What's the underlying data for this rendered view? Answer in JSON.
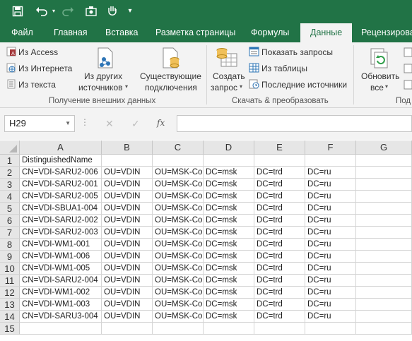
{
  "quick_access": {
    "customize": "▾"
  },
  "tabs": [
    "Файл",
    "Главная",
    "Вставка",
    "Разметка страницы",
    "Формулы",
    "Данные",
    "Рецензирова"
  ],
  "active_tab": "Данные",
  "ribbon": {
    "get_external": {
      "from_access": "Из Access",
      "from_web": "Из Интернета",
      "from_text": "Из текста",
      "other_sources_1": "Из других",
      "other_sources_2": "источников",
      "existing_1": "Существующие",
      "existing_2": "подключения",
      "group_label": "Получение внешних данных"
    },
    "transform": {
      "new_query_1": "Создать",
      "new_query_2": "запрос",
      "show_queries": "Показать запросы",
      "from_table": "Из таблицы",
      "recent_sources": "Последние источники",
      "group_label": "Скачать & преобразовать"
    },
    "connections": {
      "refresh_1": "Обновить",
      "refresh_2": "все",
      "group_label": "Под"
    }
  },
  "formula_bar": {
    "name_box": "H29",
    "fx_label": "fx",
    "value": ""
  },
  "sheet": {
    "columns": [
      "A",
      "B",
      "C",
      "D",
      "E",
      "F",
      "G"
    ],
    "rows": [
      [
        "DistinguishedName",
        "",
        "",
        "",
        "",
        "",
        ""
      ],
      [
        "CN=VDI-SARU2-006",
        "OU=VDIN",
        "OU=MSK-Cor",
        "DC=msk",
        "DC=trd",
        "DC=ru",
        ""
      ],
      [
        "CN=VDI-SARU2-001",
        "OU=VDIN",
        "OU=MSK-Cor",
        "DC=msk",
        "DC=trd",
        "DC=ru",
        ""
      ],
      [
        "CN=VDI-SARU2-005",
        "OU=VDIN",
        "OU=MSK-Cor",
        "DC=msk",
        "DC=trd",
        "DC=ru",
        ""
      ],
      [
        "CN=VDI-SBUA1-004",
        "OU=VDIN",
        "OU=MSK-Cor",
        "DC=msk",
        "DC=trd",
        "DC=ru",
        ""
      ],
      [
        "CN=VDI-SARU2-002",
        "OU=VDIN",
        "OU=MSK-Cor",
        "DC=msk",
        "DC=trd",
        "DC=ru",
        ""
      ],
      [
        "CN=VDI-SARU2-003",
        "OU=VDIN",
        "OU=MSK-Cor",
        "DC=msk",
        "DC=trd",
        "DC=ru",
        ""
      ],
      [
        "CN=VDI-WM1-001",
        "OU=VDIN",
        "OU=MSK-Cor",
        "DC=msk",
        "DC=trd",
        "DC=ru",
        ""
      ],
      [
        "CN=VDI-WM1-006",
        "OU=VDIN",
        "OU=MSK-Cor",
        "DC=msk",
        "DC=trd",
        "DC=ru",
        ""
      ],
      [
        "CN=VDI-WM1-005",
        "OU=VDIN",
        "OU=MSK-Cor",
        "DC=msk",
        "DC=trd",
        "DC=ru",
        ""
      ],
      [
        "CN=VDI-SARU2-004",
        "OU=VDIN",
        "OU=MSK-Cor",
        "DC=msk",
        "DC=trd",
        "DC=ru",
        ""
      ],
      [
        "CN=VDI-WM1-002",
        "OU=VDIN",
        "OU=MSK-Cor",
        "DC=msk",
        "DC=trd",
        "DC=ru",
        ""
      ],
      [
        "CN=VDI-WM1-003",
        "OU=VDIN",
        "OU=MSK-Cor",
        "DC=msk",
        "DC=trd",
        "DC=ru",
        ""
      ],
      [
        "CN=VDI-SARU3-004",
        "OU=VDIN",
        "OU=MSK-Cor",
        "DC=msk",
        "DC=trd",
        "DC=ru",
        ""
      ],
      [
        "",
        "",
        "",
        "",
        "",
        "",
        ""
      ]
    ]
  },
  "colors": {
    "accent": "#217346",
    "ribbon_bg": "#f3f3f3",
    "header_bg": "#e6e6e6"
  }
}
